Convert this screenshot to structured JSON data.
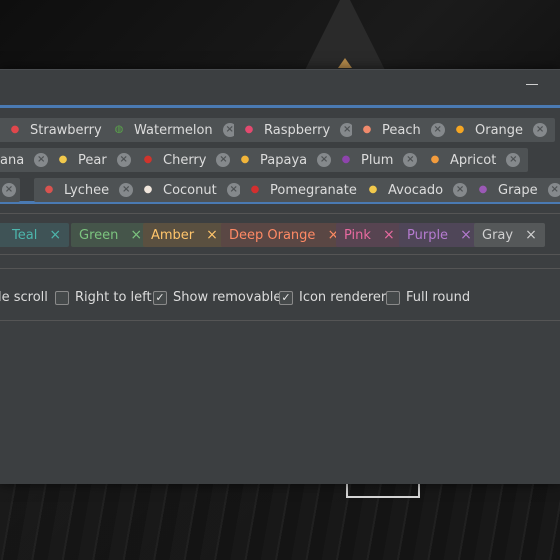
{
  "fruit_chips": {
    "row1": [
      {
        "label": "Strawberry",
        "icon": "strawberry-icon",
        "color": "#e0474c",
        "glyph": "●"
      },
      {
        "label": "Watermelon",
        "icon": "watermelon-icon",
        "color": "#5aa54a",
        "glyph": "◍"
      },
      {
        "label": "Raspberry",
        "icon": "raspberry-icon",
        "color": "#e34a6f",
        "glyph": "●"
      },
      {
        "label": "Peach",
        "icon": "peach-icon",
        "color": "#f08a6c",
        "glyph": "●"
      },
      {
        "label": "Orange",
        "icon": "orange-icon",
        "color": "#f5a623",
        "glyph": "●"
      }
    ],
    "row2": [
      {
        "label": "ana",
        "icon": "banana-icon",
        "color": "#f2c94c",
        "glyph": ""
      },
      {
        "label": "Pear",
        "icon": "pear-icon",
        "color": "#f2c94c",
        "glyph": "●"
      },
      {
        "label": "Cherry",
        "icon": "cherry-icon",
        "color": "#d0342c",
        "glyph": "●"
      },
      {
        "label": "Papaya",
        "icon": "papaya-icon",
        "color": "#f2b53a",
        "glyph": "●"
      },
      {
        "label": "Plum",
        "icon": "plum-icon",
        "color": "#8e44ad",
        "glyph": "●"
      },
      {
        "label": "Apricot",
        "icon": "apricot-icon",
        "color": "#f39c3d",
        "glyph": "●"
      }
    ],
    "row3": [
      {
        "label": "",
        "icon": "fruit-icon",
        "color": "#cccccc",
        "glyph": ""
      },
      {
        "label": "Lychee",
        "icon": "lychee-icon",
        "color": "#d9534f",
        "glyph": "●"
      },
      {
        "label": "Coconut",
        "icon": "coconut-icon",
        "color": "#f0e6dc",
        "glyph": "●"
      },
      {
        "label": "Pomegranate",
        "icon": "pomegranate-icon",
        "color": "#d32f2f",
        "glyph": "●"
      },
      {
        "label": "Avocado",
        "icon": "avocado-icon",
        "color": "#f2c94c",
        "glyph": "●"
      },
      {
        "label": "Grape",
        "icon": "grape-icon",
        "color": "#9b59b6",
        "glyph": "●"
      }
    ]
  },
  "color_chips": [
    {
      "label": "Teal",
      "text_color": "#4db6ac",
      "bg": "#3f5356"
    },
    {
      "label": "Green",
      "text_color": "#7cc47f",
      "bg": "#45554a"
    },
    {
      "label": "Amber",
      "text_color": "#ffc56b",
      "bg": "#5a5040"
    },
    {
      "label": "Deep Orange",
      "text_color": "#ff8a65",
      "bg": "#5a4744"
    },
    {
      "label": "Pink",
      "text_color": "#e86aa0",
      "bg": "#574451"
    },
    {
      "label": "Purple",
      "text_color": "#b57bd0",
      "bg": "#4f4658"
    },
    {
      "label": "Gray",
      "text_color": "#d0d0d0",
      "bg": "#555859"
    }
  ],
  "options": [
    {
      "label": "le scroll",
      "checked": null
    },
    {
      "label": "Right to left",
      "checked": false
    },
    {
      "label": "Show removable",
      "checked": true
    },
    {
      "label": "Icon renderer",
      "checked": true
    },
    {
      "label": "Full round",
      "checked": false
    }
  ],
  "remove_glyph": "×",
  "check_glyph": "✓"
}
